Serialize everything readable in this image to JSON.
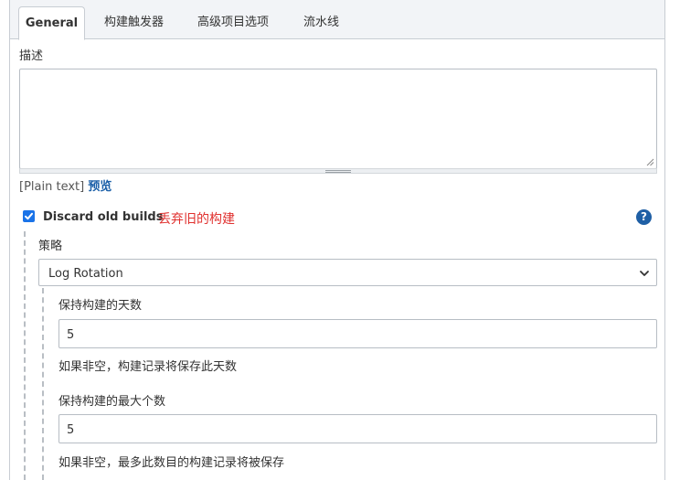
{
  "tabs": [
    {
      "label": "General",
      "active": true
    },
    {
      "label": "构建触发器"
    },
    {
      "label": "高级项目选项"
    },
    {
      "label": "流水线"
    }
  ],
  "description": {
    "label": "描述",
    "value": "",
    "markup_note": "[Plain text]",
    "preview_link": "预览"
  },
  "discard": {
    "label": "Discard old builds",
    "annotation": "丢弃旧的构建",
    "annotation_color": "#e0312f",
    "checked": true,
    "help_icon": "?"
  },
  "strategy": {
    "label": "策略",
    "selected": "Log Rotation"
  },
  "days": {
    "label": "保持构建的天数",
    "value": "5",
    "hint": "如果非空，构建记录将保存此天数"
  },
  "max_builds": {
    "label": "保持构建的最大个数",
    "value": "5",
    "hint": "如果非空，最多此数目的构建记录将被保存"
  },
  "colors": {
    "accent": "#1a73e8",
    "link": "#1a5fa8",
    "help": "#1f5fa5"
  }
}
